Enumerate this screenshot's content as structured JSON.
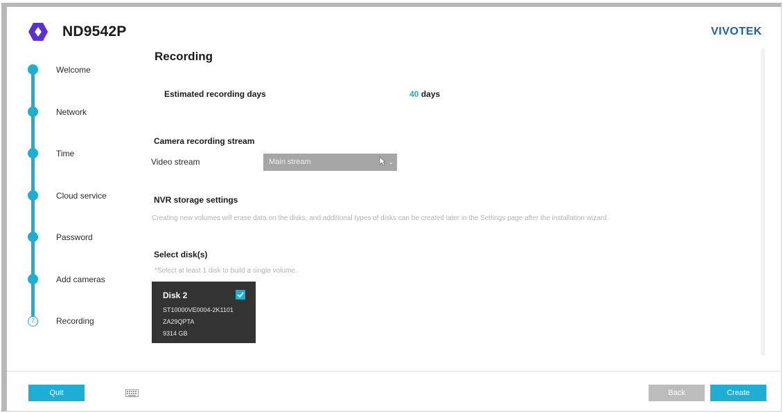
{
  "header": {
    "product_name": "ND9542P",
    "brand": "VIVOTEK",
    "brand_color": "#1f5fa8",
    "accent_color": "#1faed3",
    "logo_icon": "hexagon-logo-icon"
  },
  "steps": [
    {
      "label": "Welcome",
      "state": "done"
    },
    {
      "label": "Network",
      "state": "done"
    },
    {
      "label": "Time",
      "state": "done"
    },
    {
      "label": "Cloud service",
      "state": "done"
    },
    {
      "label": "Password",
      "state": "done"
    },
    {
      "label": "Add cameras",
      "state": "done"
    },
    {
      "label": "Recording",
      "state": "current",
      "number": "7"
    }
  ],
  "recording": {
    "title": "Recording",
    "estimated_label": "Estimated recording days",
    "estimated_value": "40",
    "estimated_unit": "days",
    "camera_stream_heading": "Camera recording stream",
    "video_stream_label": "Video stream",
    "video_stream_value": "Main stream",
    "nvr_heading": "NVR storage settings",
    "nvr_note": "Creating new volumes will erase data on the disks, and additional types of disks can be created later in the Settings page after the installation wizard.",
    "select_disks_heading": "Select disk(s)",
    "select_hint": "*Select at least 1 disk to build a single volume.",
    "disk": {
      "name": "Disk 2",
      "model": "ST10000VE0004-2K1101",
      "serial": "ZA29QPTA",
      "size": "9314 GB",
      "checked": true
    }
  },
  "footer": {
    "quit_label": "Quit",
    "back_label": "Back",
    "create_label": "Create",
    "keyboard_icon": "keyboard-icon"
  }
}
